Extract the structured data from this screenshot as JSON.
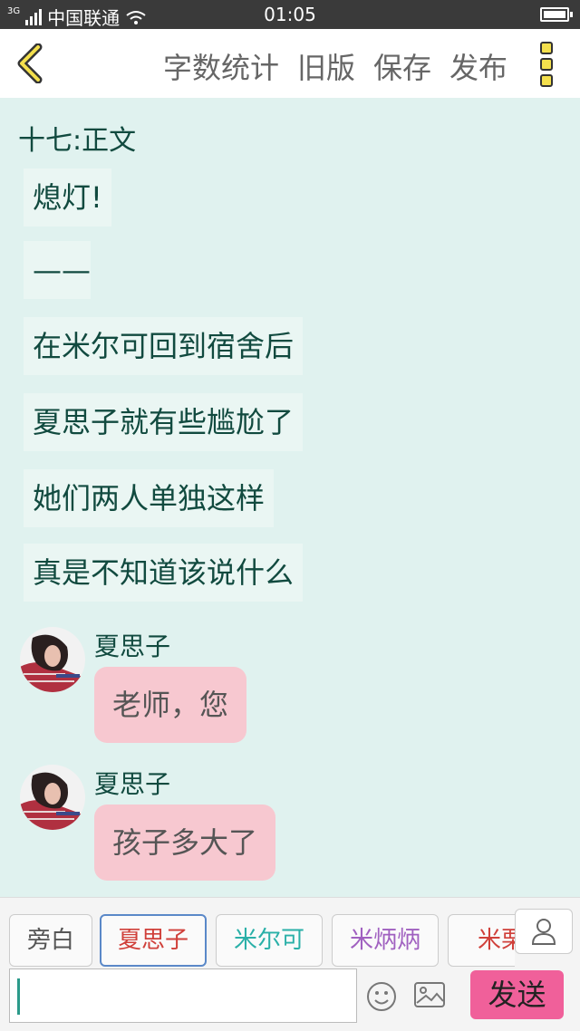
{
  "status_bar": {
    "network": "3G",
    "carrier": "中国联通",
    "time": "01:05"
  },
  "toolbar": {
    "word_count": "字数统计",
    "old_version": "旧版",
    "save": "保存",
    "publish": "发布"
  },
  "chapter_title": "十七:正文",
  "narration": [
    "熄灯!",
    "——",
    "在米尔可回到宿舍后",
    "夏思子就有些尴尬了",
    "她们两人单独这样",
    "真是不知道该说什么"
  ],
  "messages": [
    {
      "sender": "夏思子",
      "text": "老师，您"
    },
    {
      "sender": "夏思子",
      "text": "孩子多大了"
    }
  ],
  "roles": [
    {
      "label": "旁白",
      "color": "#555555"
    },
    {
      "label": "夏思子",
      "color": "#d0403a"
    },
    {
      "label": "米尔可",
      "color": "#2ab0a8"
    },
    {
      "label": "米炳炳",
      "color": "#a060c0"
    },
    {
      "label": "米栗",
      "color": "#d0403a"
    }
  ],
  "composer": {
    "input_value": "",
    "send_label": "发送"
  },
  "colors": {
    "background": "#e0f2ef",
    "narration_text": "#114a3f",
    "bubble": "#f7c8d0",
    "send_button": "#f0609a"
  }
}
